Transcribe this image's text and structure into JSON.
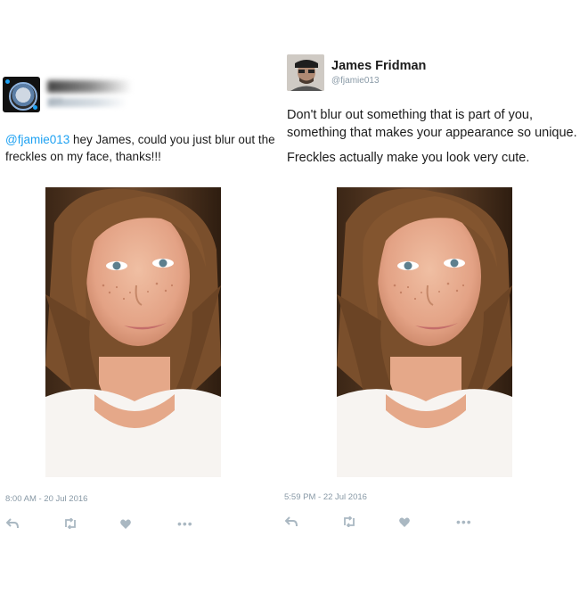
{
  "left_tweet": {
    "handle_fragment": "@fi",
    "text_mention": "@fjamie013",
    "text_body": " hey James, could you just blur out the freckles on my face, thanks!!!",
    "timestamp": "8:00 AM - 20 Jul 2016"
  },
  "right_tweet": {
    "author_name": "James Fridman",
    "author_handle": "@fjamie013",
    "paragraph_1": "Don't blur out something that is part of you, something that makes your appearance so unique.",
    "paragraph_2": "Freckles actually make you look very cute.",
    "timestamp": "5:59 PM - 22 Jul 2016"
  },
  "actions": {
    "more_label": "•••",
    "icons": [
      "reply-icon",
      "retweet-icon",
      "like-icon",
      "more-icon"
    ]
  },
  "colors": {
    "link": "#1da1f2",
    "meta": "#8899a6",
    "action_icon": "#aab8c2"
  }
}
